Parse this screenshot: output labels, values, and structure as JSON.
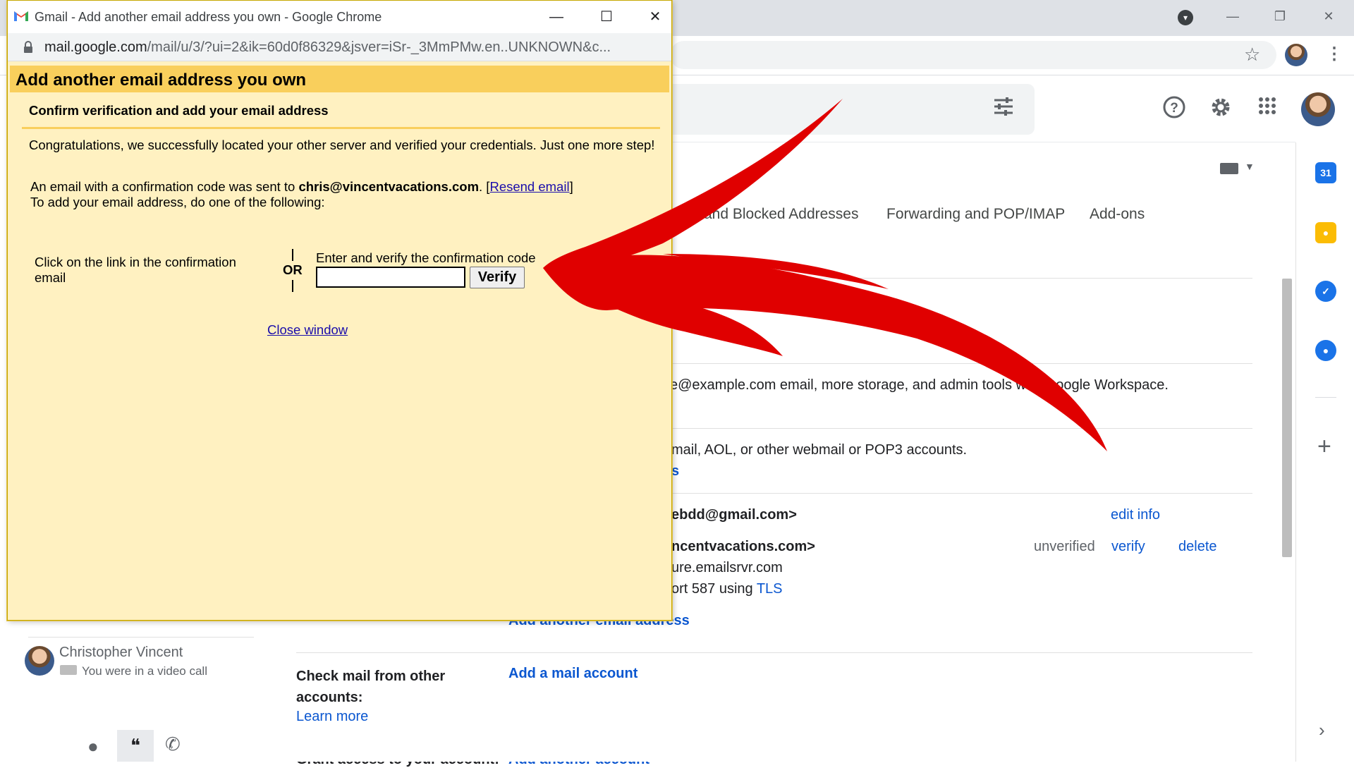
{
  "popup": {
    "window_title": "Gmail - Add another email address you own - Google Chrome",
    "url_host": "mail.google.com",
    "url_path": "/mail/u/3/?ui=2&ik=60d0f86329&jsver=iSr-_3MmPMw.en..UNKNOWN&c...",
    "heading": "Add another email address you own",
    "subheading": "Confirm verification and add your email address",
    "congrats_text": "Congratulations, we successfully located your other server and verified your credentials. Just one more step!",
    "sent_prefix": "An email with a confirmation code was sent to ",
    "sent_email": "chris@vincentvacations.com",
    "sent_suffix": ". [",
    "resend_link": "Resend email",
    "sent_close": "]",
    "instructions": "To add your email address, do one of the following:",
    "option_link_text": "Click on the link in the confirmation email",
    "or_label": "OR",
    "option_code_text": "Enter and verify the confirmation code",
    "code_input_value": "",
    "verify_button": "Verify",
    "close_window": "Close window"
  },
  "gmail": {
    "tabs": [
      "and Blocked Addresses",
      "Forwarding and POP/IMAP",
      "Add-ons"
    ],
    "workspace_text": "e@example.com email, more storage, and admin tools with Google Workspace.",
    "webmail_text": "mail, AOL, or other webmail or POP3 accounts.",
    "webmail_link_fragment": "s",
    "ns_fragment": "ns",
    "account1": "ebdd@gmail.com>",
    "edit_info": "edit info",
    "account2": "ncentvacations.com>",
    "unverified": "unverified",
    "verify_link": "verify",
    "delete_link": "delete",
    "smtp_server": "ure.emailsrvr.com",
    "smtp_port_prefix": "ort 587 using ",
    "smtp_tls": "TLS",
    "add_another_email": "Add another email address",
    "check_mail_label": "Check mail from other accounts:",
    "learn_more": "Learn more",
    "add_mail_account": "Add a mail account",
    "grant_access_label": "Grant access to your account:",
    "add_another_account": "Add another account"
  },
  "chat": {
    "name": "Christopher Vincent",
    "status": "You were in a video call"
  },
  "colors": {
    "popup_header": "#f9cf5c",
    "popup_body": "#fff1c1",
    "arrow": "#e00000",
    "link_blue": "#0b57d0"
  }
}
